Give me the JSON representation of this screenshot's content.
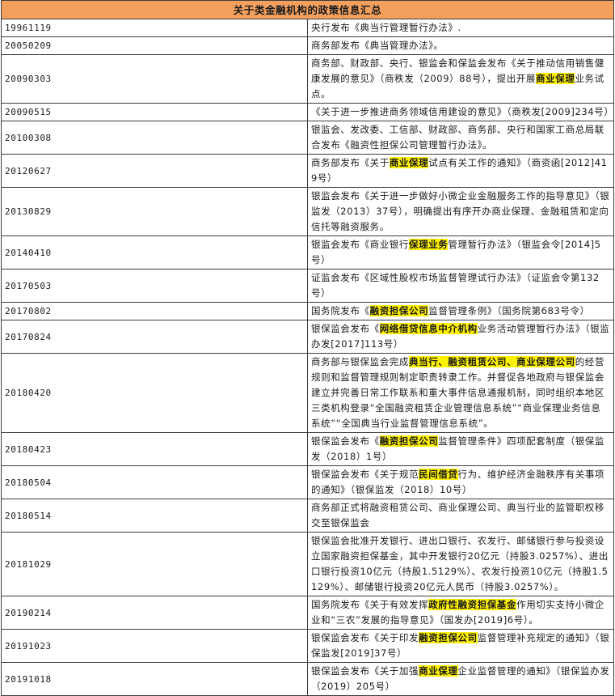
{
  "title": "关于类金融机构的政策信息汇总",
  "highlight_color": "#fff200",
  "header_color": "#f3a05f",
  "rows": [
    {
      "date": "19961119",
      "segments": [
        {
          "t": "央行发布《典当行管理暂行办法》."
        }
      ]
    },
    {
      "date": "20050209",
      "segments": [
        {
          "t": "商务部发布《典当管理办法》。"
        }
      ]
    },
    {
      "date": "20090303",
      "segments": [
        {
          "t": "商务部、财政部、央行、银监会和保监会发布《关于推动信用销售健康发展的意见》（商秩发（2009）88号），提出开展"
        },
        {
          "t": "商业保理",
          "hl": true
        },
        {
          "t": "业务试点。"
        }
      ]
    },
    {
      "date": "20090515",
      "segments": [
        {
          "t": "《关于进一步推进商务领域信用建设的意见》（商秩发[2009]234号）"
        }
      ]
    },
    {
      "date": "20100308",
      "segments": [
        {
          "t": "银监会、发改委、工信部、财政部、商务部、央行和国家工商总局联合发布《融资性担保公司管理暂行办法》。"
        }
      ]
    },
    {
      "date": "20120627",
      "segments": [
        {
          "t": "商务部发布《关于"
        },
        {
          "t": "商业保理",
          "hl": true
        },
        {
          "t": "试点有关工作的通知》（商资函[2012]419号）"
        }
      ]
    },
    {
      "date": "20130829",
      "segments": [
        {
          "t": "银监会发布《关于进一步做好小微企业金融服务工作的指导意见》（银监发（2013）37号），明确提出有序开办商业保理、金融租赁和定向信托等融资服务。"
        }
      ]
    },
    {
      "date": "20140410",
      "segments": [
        {
          "t": "银监会发布《商业银行"
        },
        {
          "t": "保理业务",
          "hl": true
        },
        {
          "t": "管理暂行办法》（银监会令[2014]5号）"
        }
      ]
    },
    {
      "date": "20170503",
      "segments": [
        {
          "t": "证监会发布《区域性股权市场监督管理试行办法》（证监会令第132号）"
        }
      ]
    },
    {
      "date": "20170802",
      "segments": [
        {
          "t": "国务院发布《"
        },
        {
          "t": "融资担保公司",
          "hl": true
        },
        {
          "t": "监督管理条例》（国务院第683号令）"
        }
      ]
    },
    {
      "date": "20170824",
      "segments": [
        {
          "t": "银保监会发布《"
        },
        {
          "t": "网络借贷信息中介机构",
          "hl": true
        },
        {
          "t": "业务活动管理暂行办法》（银监办发[2017]113号）"
        }
      ]
    },
    {
      "date": "20180420",
      "segments": [
        {
          "t": "商务部与银保监会完成"
        },
        {
          "t": "典当行、融资租赁公司、商业保理公司",
          "hl": true
        },
        {
          "t": "的经营规则和监督管理规则制定职责转隶工作。并督促各地政府与银保监会建立并完善日常工作联系和重大事件信息通报机制，同时组织本地区三类机构登录“全国融资租赁企业管理信息系统”“商业保理业务信息系统”“全国典当行业监督管理信息系统”。"
        }
      ]
    },
    {
      "date": "20180423",
      "segments": [
        {
          "t": "银保监会发布《"
        },
        {
          "t": "融资担保公司",
          "hl": true
        },
        {
          "t": "监督管理条件》四项配套制度（银保监发（2018）1号）"
        }
      ]
    },
    {
      "date": "20180504",
      "segments": [
        {
          "t": "银保监会发布《关于规范"
        },
        {
          "t": "民间借贷",
          "hl": true
        },
        {
          "t": "行为、维护经济金融秩序有关事项的通知》（银保监发（2018）10号）"
        }
      ]
    },
    {
      "date": "20180514",
      "segments": [
        {
          "t": "商务部正式将融资租赁公司、商业保理公司、典当行业的监管职权移交至银保监会"
        }
      ]
    },
    {
      "date": "20181029",
      "segments": [
        {
          "t": "银保监会批准开发银行、进出口银行、农发行、邮储银行参与投资设立国家融资担保基金，其中开发银行20亿元（持股3.0257%）、进出口银行投资10亿元（持股1.5129%）、农发行投资10亿元（持股1.5129%）、邮储银行投资20亿元人民币（持股3.0257%）。"
        }
      ]
    },
    {
      "date": "20190214",
      "segments": [
        {
          "t": "国务院发布《关于有效发挥"
        },
        {
          "t": "政府性融资担保基金",
          "hl": true
        },
        {
          "t": "作用切实支持小微企业和“三农”发展的指导意见》（国发办[2019]6号）。"
        }
      ]
    },
    {
      "date": "20191023",
      "segments": [
        {
          "t": "银保监会发布《关于印发"
        },
        {
          "t": "融资担保公司",
          "hl": true
        },
        {
          "t": "监督管理补充规定的通知》（银保监发[2019]37号）"
        }
      ]
    },
    {
      "date": "20191018",
      "segments": [
        {
          "t": "银保监会发布《关于加强"
        },
        {
          "t": "商业保理",
          "hl": true
        },
        {
          "t": "企业监督管理的通知》（银保监办发（2019）205号）"
        }
      ]
    }
  ]
}
